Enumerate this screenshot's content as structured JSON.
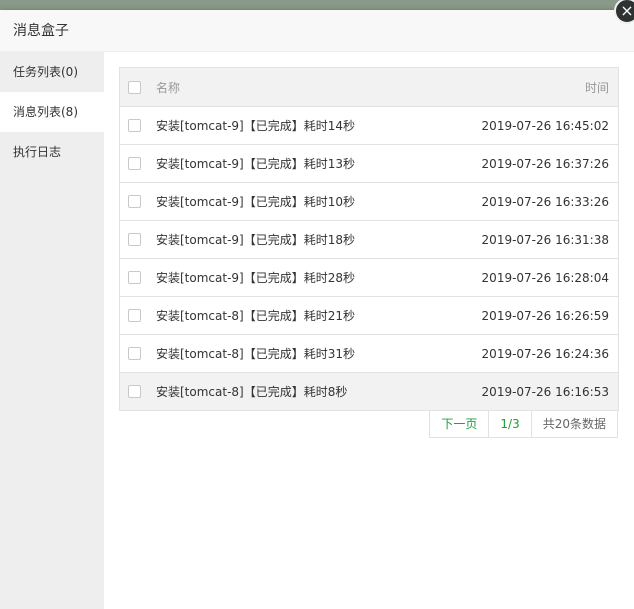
{
  "dialog": {
    "title": "消息盒子",
    "close_glyph": "×"
  },
  "sidebar": {
    "items": [
      {
        "label": "任务列表(0)"
      },
      {
        "label": "消息列表(8)"
      },
      {
        "label": "执行日志"
      }
    ]
  },
  "table": {
    "headers": {
      "name": "名称",
      "time": "时间"
    },
    "rows": [
      {
        "name": "安装[tomcat-9]【已完成】耗时14秒",
        "time": "2019-07-26 16:45:02"
      },
      {
        "name": "安装[tomcat-9]【已完成】耗时13秒",
        "time": "2019-07-26 16:37:26"
      },
      {
        "name": "安装[tomcat-9]【已完成】耗时10秒",
        "time": "2019-07-26 16:33:26"
      },
      {
        "name": "安装[tomcat-9]【已完成】耗时18秒",
        "time": "2019-07-26 16:31:38"
      },
      {
        "name": "安装[tomcat-9]【已完成】耗时28秒",
        "time": "2019-07-26 16:28:04"
      },
      {
        "name": "安装[tomcat-8]【已完成】耗时21秒",
        "time": "2019-07-26 16:26:59"
      },
      {
        "name": "安装[tomcat-8]【已完成】耗时31秒",
        "time": "2019-07-26 16:24:36"
      },
      {
        "name": "安装[tomcat-8]【已完成】耗时8秒",
        "time": "2019-07-26 16:16:53"
      }
    ]
  },
  "pager": {
    "next": "下一页",
    "page": "1/3",
    "total": "共20条数据"
  },
  "colors": {
    "accent": "#1e9f3a",
    "sidebar_bg": "#eeeeee"
  }
}
